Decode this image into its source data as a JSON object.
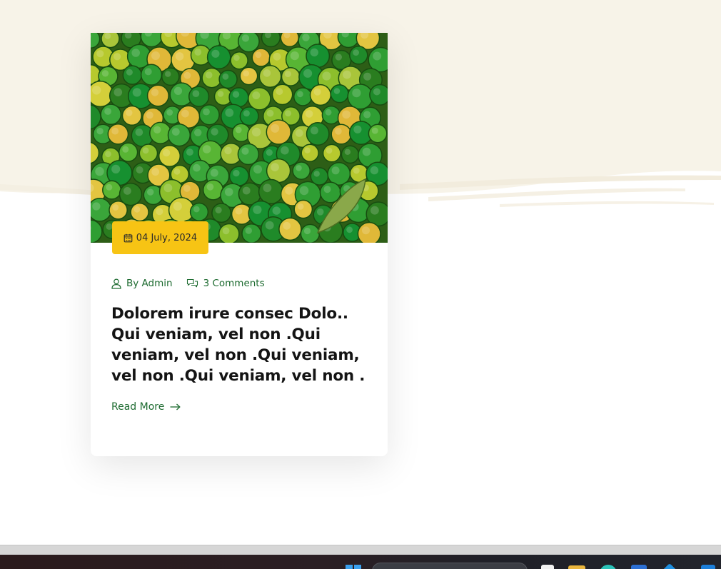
{
  "post": {
    "date": "04 July, 2024",
    "author": "By Admin",
    "comments": "3 Comments",
    "title": "Dolorem irure consec Dolo.. Qui veniam, vel non .Qui veniam, vel non .Qui veniam, vel non .Qui veniam, vel non .",
    "read_more": "Read More"
  },
  "icons": {
    "date": "calendar-icon",
    "author": "user-icon",
    "comments": "comments-icon",
    "read_more": "arrow-right-icon"
  },
  "colors": {
    "accent_green": "#1d6b30",
    "badge_yellow": "#f7c414",
    "cream_background": "#f7f3e8",
    "title_text": "#141414"
  },
  "taskbar": {
    "icons": [
      "windows-start-icon",
      "search-box",
      "file-manager-icon",
      "folder-icon",
      "edge-browser-icon",
      "store-icon",
      "vscode-icon"
    ]
  }
}
